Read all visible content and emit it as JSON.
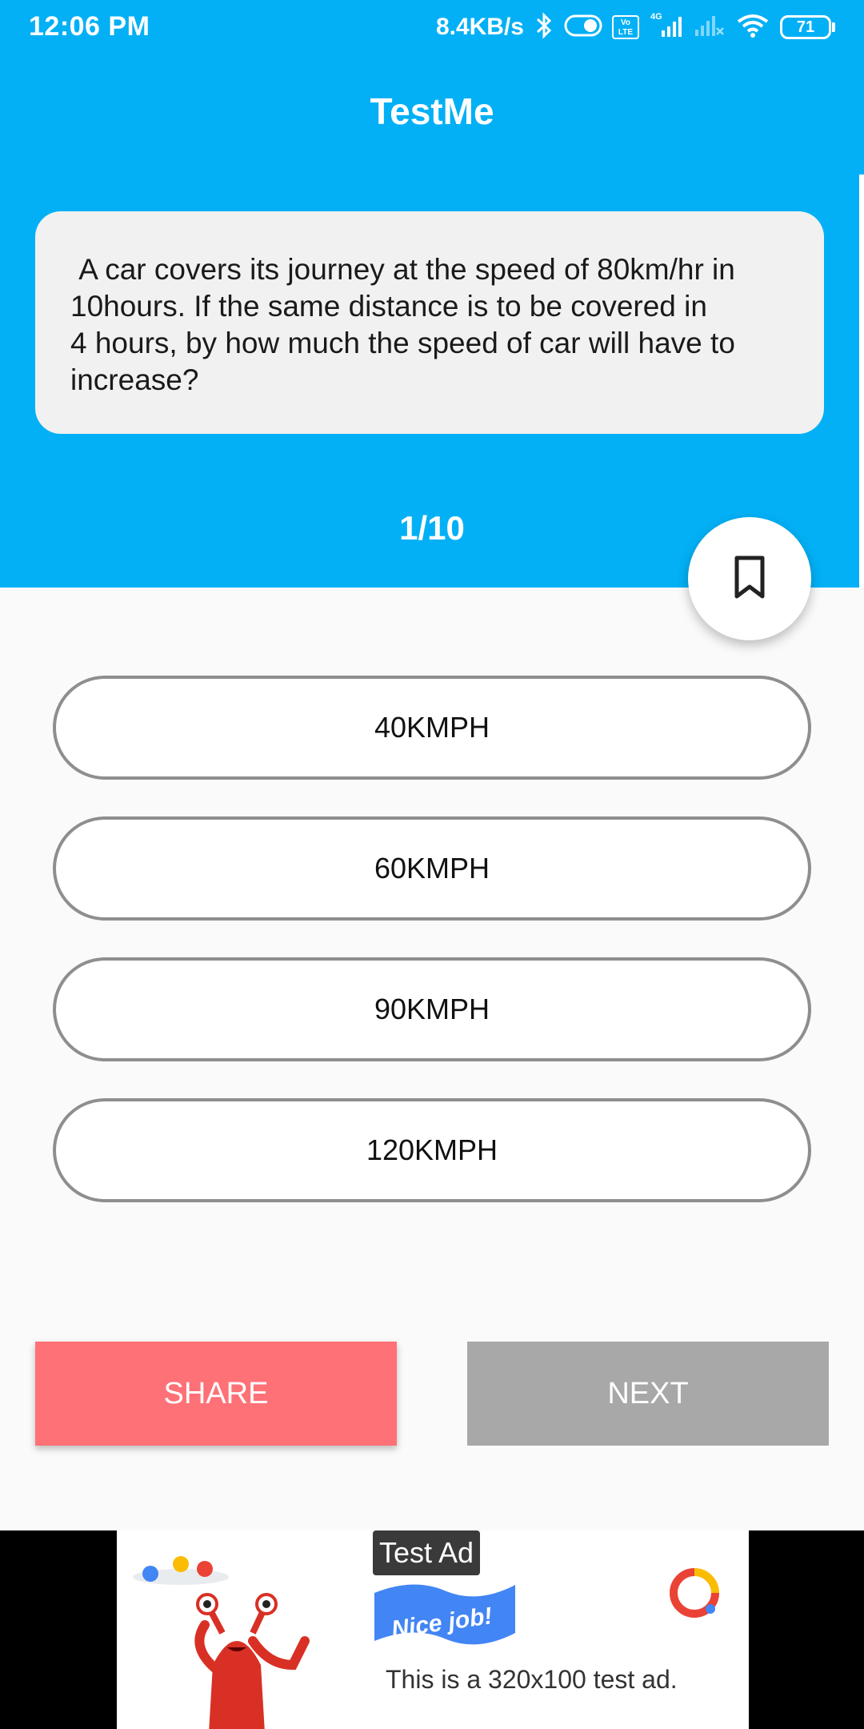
{
  "status_bar": {
    "time": "12:06 PM",
    "net_speed": "8.4KB/s",
    "volte_label": "Vo LTE",
    "network_label": "4G",
    "battery_level": "71"
  },
  "app": {
    "title": "TestMe"
  },
  "question": {
    "text": " A car covers its journey at the speed of 80km/hr in\n10hours. If the same distance is to be covered in\n4 hours, by how much the speed of car will have to\nincrease?",
    "progress": "1/10"
  },
  "options": [
    "40KMPH",
    "60KMPH",
    "90KMPH",
    "120KMPH"
  ],
  "actions": {
    "share_label": "SHARE",
    "next_label": "NEXT"
  },
  "ad": {
    "label": "Test Ad",
    "flag_text": "Nice job!",
    "body": "This is a 320x100 test ad."
  },
  "colors": {
    "primary": "#03b0f5",
    "share": "#fe7177",
    "next_disabled": "#a8a8a8",
    "option_border": "#8e8e8e"
  },
  "icons": {
    "bookmark": "bookmark-outline-icon",
    "bluetooth": "bluetooth-icon",
    "wifi": "wifi-icon"
  }
}
